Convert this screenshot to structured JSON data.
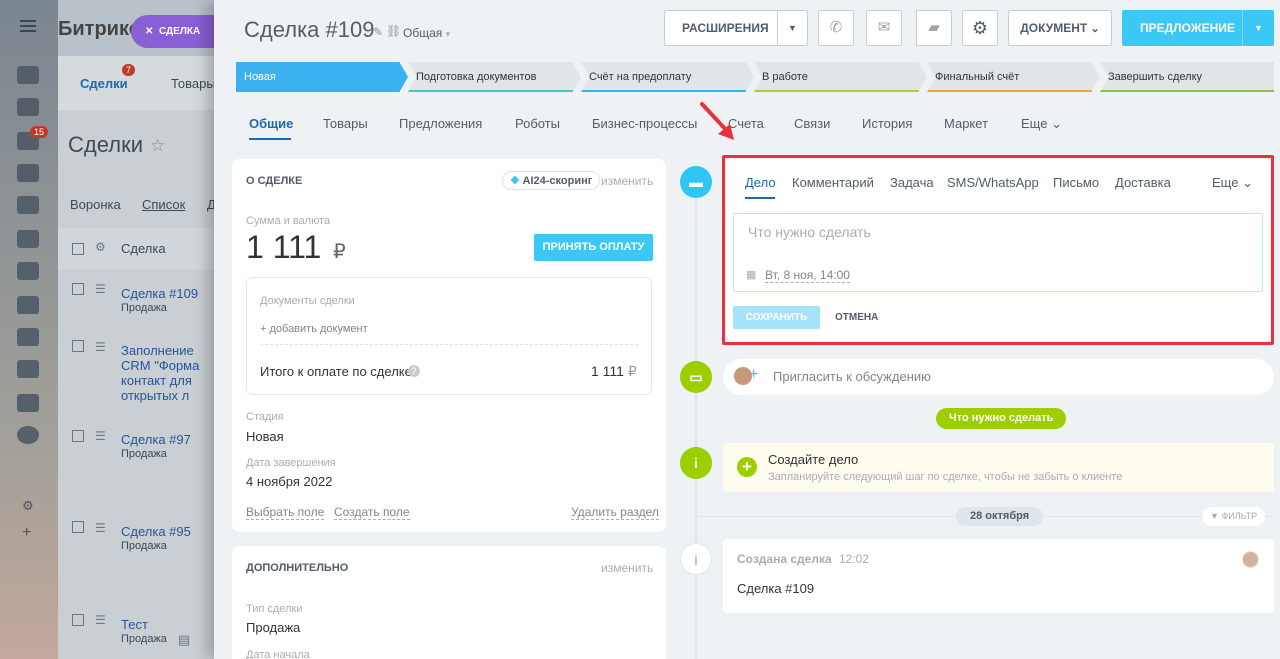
{
  "background": {
    "brand": "Битрикс",
    "deal_pill": "СДЕЛКА",
    "top_tabs": [
      {
        "label": "Сделки",
        "badge": "7"
      },
      {
        "label": "Товары"
      }
    ],
    "nav_badge": "15",
    "page_title": "Сделки",
    "view_tabs": [
      "Воронка",
      "Список",
      "Д"
    ],
    "grid_header": "Сделка",
    "rows": [
      {
        "title": "Сделка #109",
        "sub": "Продажа"
      },
      {
        "title": "Заполнение CRM \"Форма контакт для открытых л",
        "sub": ""
      },
      {
        "title": "Сделка #97",
        "sub": "Продажа"
      },
      {
        "title": "Сделка #95",
        "sub": "Продажа"
      },
      {
        "title": "Тест",
        "sub": "Продажа"
      }
    ]
  },
  "header": {
    "title": "Сделка #109",
    "category": "Общая",
    "buttons": {
      "extensions": "РАСШИРЕНИЯ",
      "document": "ДОКУМЕНТ",
      "proposal": "ПРЕДЛОЖЕНИЕ"
    }
  },
  "stages": [
    {
      "label": "Новая",
      "color": "#3bb1f0"
    },
    {
      "label": "Подготовка документов",
      "color": "#48c4c8"
    },
    {
      "label": "Счёт на предоплату",
      "color": "#3bb1f0"
    },
    {
      "label": "В работе",
      "color": "#a1d13b"
    },
    {
      "label": "Финальный счёт",
      "color": "#f3a33a"
    },
    {
      "label": "Завершить сделку",
      "color": "#8bc34a"
    }
  ],
  "tabs": [
    "Общие",
    "Товары",
    "Предложения",
    "Роботы",
    "Бизнес-процессы",
    "Счета",
    "Связи",
    "История",
    "Маркет",
    "Еще"
  ],
  "about": {
    "section_title": "О СДЕЛКЕ",
    "scoring": "AI24-скоринг",
    "edit": "изменить",
    "amount_label": "Сумма и валюта",
    "amount": "1 111",
    "currency": "₽",
    "pay_button": "ПРИНЯТЬ ОПЛАТУ",
    "docs_label": "Документы сделки",
    "add_doc": "+ добавить документ",
    "total_label": "Итого к оплате по сделке",
    "total_value": "1 111",
    "stage_label": "Стадия",
    "stage_value": "Новая",
    "close_label": "Дата завершения",
    "close_value": "4 ноября 2022",
    "select_field": "Выбрать поле",
    "create_field": "Создать поле",
    "delete_section": "Удалить раздел"
  },
  "extra": {
    "section_title": "ДОПОЛНИТЕЛЬНО",
    "edit": "изменить",
    "type_label": "Тип сделки",
    "type_value": "Продажа",
    "start_label": "Дата начала"
  },
  "composer": {
    "tabs": [
      "Дело",
      "Комментарий",
      "Задача",
      "SMS/WhatsApp",
      "Письмо",
      "Доставка",
      "Еще"
    ],
    "placeholder": "Что нужно сделать",
    "deadline": "Вт, 8 ноя, 14:00",
    "save": "СОХРАНИТЬ",
    "cancel": "ОТМЕНА"
  },
  "timeline": {
    "invite": "Пригласить к обсуждению",
    "todo_badge": "Что нужно сделать",
    "create_title": "Создайте дело",
    "create_sub": "Запланируйте следующий шаг по сделке, чтобы не забыть о клиенте",
    "date_badge": "28 октября",
    "filter": "ФИЛЬТР",
    "event_title": "Создана сделка",
    "event_time": "12:02",
    "event_body": "Сделка #109"
  },
  "colors": {
    "accent": "#3bc8f5",
    "highlight": "#e8333c",
    "green": "#9dcf00"
  }
}
